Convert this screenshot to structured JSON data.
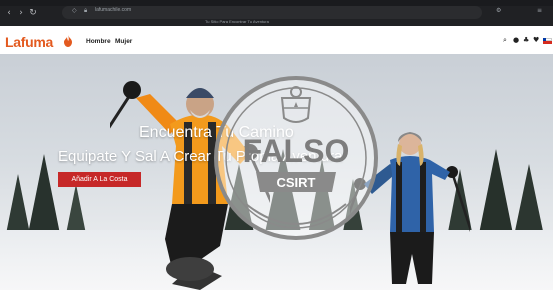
{
  "browser": {
    "url": "lafumachile.com",
    "tab_title": "Tu Sitio Para Encontrar Tu Aventura"
  },
  "site": {
    "logo": "Lafuma",
    "menu": [
      {
        "label": "Hombre"
      },
      {
        "label": "Mujer"
      }
    ],
    "icons": [
      "search-icon",
      "account-icon",
      "wishlist-icon",
      "heart-icon",
      "flag-chile-icon"
    ]
  },
  "hero": {
    "title": "Encuentra Tu Camino",
    "subtitle": "Equipate Y Sal A Crear Tu Propia Aventura",
    "cta_label": "Añadir A La Costa"
  },
  "stamp": {
    "word": "FALSO",
    "org": "CSIRT"
  },
  "colors": {
    "brand": "#e35a1f",
    "cta": "#c62828",
    "stamp": "#8a8a8a"
  }
}
